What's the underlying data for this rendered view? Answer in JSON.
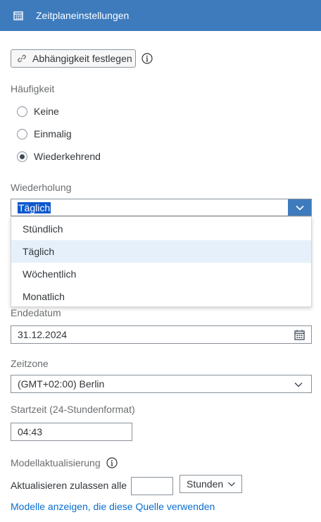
{
  "header": {
    "title": "Zeitplaneinstellungen",
    "icon": "calendar-icon",
    "color": "#3d7bbd"
  },
  "dependency_button": {
    "label": "Abhängigkeit festlegen",
    "icon": "link-icon"
  },
  "frequency": {
    "label": "Häufigkeit",
    "options": [
      {
        "label": "Keine",
        "selected": false
      },
      {
        "label": "Einmalig",
        "selected": false
      },
      {
        "label": "Wiederkehrend",
        "selected": true
      }
    ]
  },
  "repeat": {
    "label": "Wiederholung",
    "value": "Täglich",
    "options": [
      "Stündlich",
      "Täglich",
      "Wöchentlich",
      "Monatlich"
    ],
    "selected_index": 1
  },
  "end_date": {
    "label": "Endedatum",
    "value": "31.12.2024",
    "icon": "calendar-icon"
  },
  "timezone": {
    "label": "Zeitzone",
    "value": "(GMT+02:00) Berlin"
  },
  "start_time": {
    "label": "Startzeit (24-Stundenformat)",
    "value": "04:43"
  },
  "model_refresh": {
    "label": "Modellaktualisierung",
    "allow_label": "Aktualisieren zulassen alle",
    "interval_value": "",
    "unit": "Stunden"
  },
  "link": {
    "label": "Modelle anzeigen, die diese Quelle verwenden"
  }
}
